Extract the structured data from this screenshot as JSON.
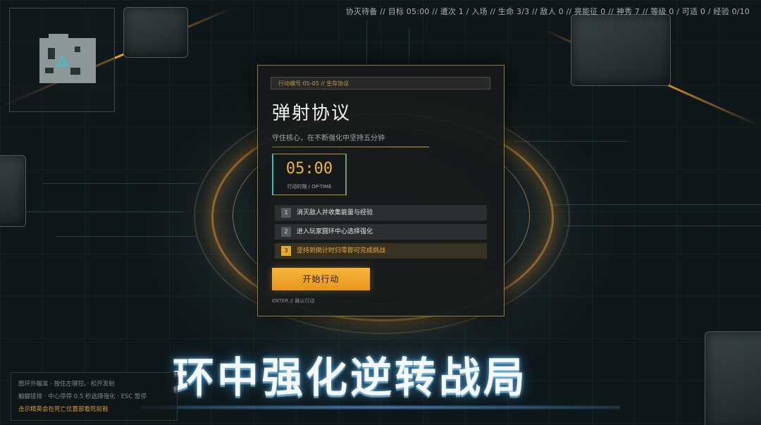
{
  "status": {
    "text": "协灭待备 // 目标 05:00 // 遭次 1 / 入场 // 生命 3/3 // 敌人 0 // 亮能征 0 // 神秀 7 // 等级 0 / 可适 0 / 经验 0/10"
  },
  "mission": {
    "code": "行动编号 05-05 // 生存协议",
    "title": "弹射协议",
    "description": "守住核心，在不断强化中坚持五分钟",
    "timer": {
      "value": "05:00",
      "label": "行动时限 / OP-TIME"
    },
    "objectives": [
      {
        "num": "1",
        "text": "消灭敌人并收集能量与经验"
      },
      {
        "num": "2",
        "text": "进入玩家圆环中心选择强化"
      },
      {
        "num": "3",
        "text": "坚持到倒计时归零即可完成挑战"
      }
    ],
    "start_label": "开始行动",
    "enter_hint": "ENTER // 确认行动"
  },
  "banner": "环中强化逆转战局",
  "controls": {
    "line1": "图环外瞄准 · 按住左键控。· 松开发射",
    "line2": "触腱接排 · 中心停停 0.5 秒选择强化 · ESC 暂停",
    "line3": "击示精英会在死亡位置部看死前鞋"
  },
  "colors": {
    "accent": "#f0a52c",
    "cyan": "#42b7c8",
    "frame": "#8c7a43"
  },
  "icons": {
    "player": "triangle-player-icon"
  }
}
